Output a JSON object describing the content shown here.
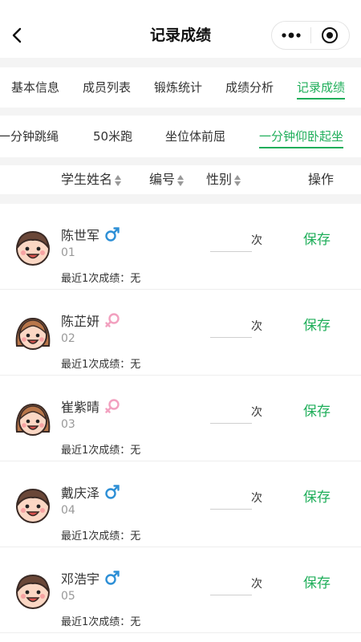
{
  "header": {
    "title": "记录成绩"
  },
  "tabs": [
    {
      "label": "基本信息"
    },
    {
      "label": "成员列表"
    },
    {
      "label": "锻炼统计"
    },
    {
      "label": "成绩分析"
    },
    {
      "label": "记录成绩",
      "active": true
    }
  ],
  "subtabs": [
    {
      "label": "一分钟跳绳"
    },
    {
      "label": "50米跑"
    },
    {
      "label": "坐位体前屈"
    },
    {
      "label": "一分钟仰卧起坐",
      "active": true
    }
  ],
  "table": {
    "col_name": "学生姓名",
    "col_number": "编号",
    "col_gender": "性别",
    "col_action": "操作"
  },
  "students": [
    {
      "name": "陈世军",
      "number": "01",
      "gender": "male",
      "avatar": "boy-avatar-icon",
      "score": "",
      "unit": "次",
      "recent_label": "最近1次成绩：",
      "recent_value": "无",
      "save": "保存"
    },
    {
      "name": "陈芷妍",
      "number": "02",
      "gender": "female",
      "avatar": "girl-avatar-icon",
      "score": "",
      "unit": "次",
      "recent_label": "最近1次成绩：",
      "recent_value": "无",
      "save": "保存"
    },
    {
      "name": "崔紫晴",
      "number": "03",
      "gender": "female",
      "avatar": "girl-avatar-icon",
      "score": "",
      "unit": "次",
      "recent_label": "最近1次成绩：",
      "recent_value": "无",
      "save": "保存"
    },
    {
      "name": "戴庆泽",
      "number": "04",
      "gender": "male",
      "avatar": "boy-avatar-icon",
      "score": "",
      "unit": "次",
      "recent_label": "最近1次成绩：",
      "recent_value": "无",
      "save": "保存"
    },
    {
      "name": "邓浩宇",
      "number": "05",
      "gender": "male",
      "avatar": "boy-avatar-icon",
      "score": "",
      "unit": "次",
      "recent_label": "最近1次成绩：",
      "recent_value": "无",
      "save": "保存"
    }
  ],
  "colors": {
    "accent": "#1fae5a",
    "male": "#2d8fd6",
    "female": "#f2a0bf"
  }
}
